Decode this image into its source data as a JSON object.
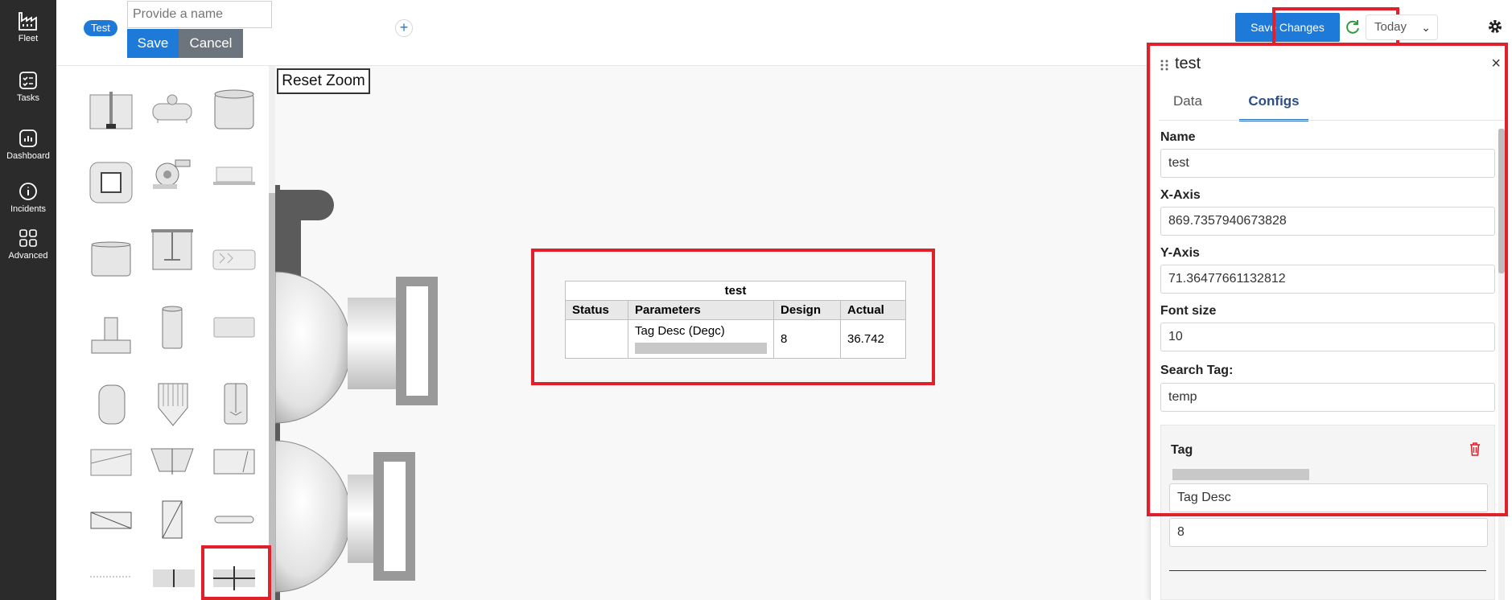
{
  "nav": {
    "items": [
      {
        "label": "Fleet",
        "icon": "factory-icon"
      },
      {
        "label": "Tasks",
        "icon": "tasks-icon"
      },
      {
        "label": "Dashboard",
        "icon": "dashboard-icon"
      },
      {
        "label": "Incidents",
        "icon": "info-icon"
      },
      {
        "label": "Advanced",
        "icon": "grid-icon"
      }
    ]
  },
  "header": {
    "tab_pill": "Test",
    "name_placeholder": "Provide a name",
    "save_label": "Save",
    "cancel_label": "Cancel",
    "add_label": "+",
    "save_changes_label": "Save Changes",
    "date_range": "Today"
  },
  "canvas": {
    "reset_zoom_label": "Reset Zoom",
    "widget_table": {
      "title": "test",
      "columns": [
        "Status",
        "Parameters",
        "Design",
        "Actual"
      ],
      "rows": [
        {
          "status": "",
          "parameter": "Tag Desc (Degc)",
          "design": "8",
          "actual": "36.742"
        }
      ]
    }
  },
  "panel": {
    "title": "test",
    "close_label": "×",
    "tabs": [
      "Data",
      "Configs"
    ],
    "active_tab": "Configs",
    "fields": {
      "name_label": "Name",
      "name_value": "test",
      "xaxis_label": "X-Axis",
      "xaxis_value": "869.7357940673828",
      "yaxis_label": "Y-Axis",
      "yaxis_value": "71.36477661132812",
      "fontsize_label": "Font size",
      "fontsize_value": "10",
      "search_tag_label": "Search Tag:",
      "search_tag_value": "temp"
    },
    "tag": {
      "label": "Tag",
      "desc_value": "Tag Desc",
      "design_value": "8"
    }
  },
  "colors": {
    "accent": "#1e7ad8",
    "highlight": "#e0202a",
    "nav_bg": "#2b2b2b"
  }
}
